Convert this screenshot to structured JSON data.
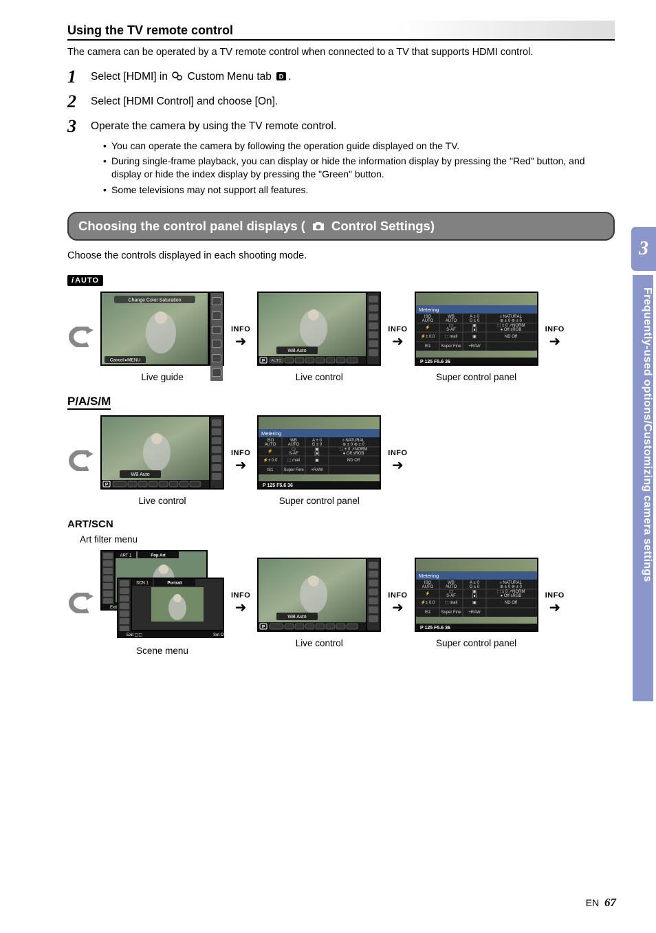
{
  "section_title": "Using the TV remote control",
  "intro": "The camera can be operated by a TV remote control when connected to a TV that supports HDMI control.",
  "steps": [
    {
      "num": "1",
      "text_pre": "Select [HDMI] in ",
      "text_post": " Custom Menu tab "
    },
    {
      "num": "2",
      "text": "Select [HDMI Control] and choose [On]."
    },
    {
      "num": "3",
      "text": "Operate the camera by using the TV remote control."
    }
  ],
  "bullets": [
    "You can operate the camera by following the operation guide displayed on the TV.",
    "During single-frame playback, you can display or hide the information display by pressing the \"Red\" button, and display or hide the index display by pressing the \"Green\" button.",
    "Some televisions may not support all features."
  ],
  "band_pre": "Choosing the control panel displays (",
  "band_post": " Control Settings)",
  "choose": "Choose the controls displayed in each shooting mode.",
  "labels": {
    "iauto": "AUTO",
    "pasm": "P/A/S/M",
    "artscn": "ART/SCN",
    "artfilter": "Art filter menu",
    "scenemenu": "Scene menu",
    "liveguide": "Live guide",
    "livecontrol": "Live control",
    "scp": "Super control panel",
    "info": "INFO"
  },
  "side": {
    "chapter": "3",
    "text": "Frequently-used options/Customizing camera settings"
  },
  "page": {
    "lang": "EN",
    "num": "67"
  },
  "lc": {
    "wb": "WB Auto",
    "mode": "P",
    "strip": "AUTO"
  },
  "scp": {
    "title": "Metering",
    "r1": [
      "ISO\nAUTO",
      "WB\nAUTO",
      "A ± 0\nG ± 0",
      "⬨ NATURAL\n⊛ ± 0   ⊚ ± 0"
    ],
    "r2": [
      "⚡",
      "▢\nS-AF",
      "▣\n[∎]",
      "⬚ ± 0   ↗NORM\n● Off    sRGB"
    ],
    "r3": [
      "⚡± 0.0",
      "⬚ mall",
      "▣",
      "ND Off"
    ],
    "r4": [
      "IS1",
      "Super Fine",
      "+RAW",
      ""
    ],
    "bottom": "P        125   F5.6                        36"
  },
  "lg": {
    "title": "Change Color Saturation",
    "cancel": "Cancel ▸MENU"
  },
  "art": {
    "tab": "ART  1",
    "name": "Pop Art",
    "exit": "Exit ▢▢"
  },
  "scn": {
    "tab": "SCN  1",
    "name": "Portrait",
    "exit": "Exit ▢▢",
    "set": "Set OK"
  }
}
